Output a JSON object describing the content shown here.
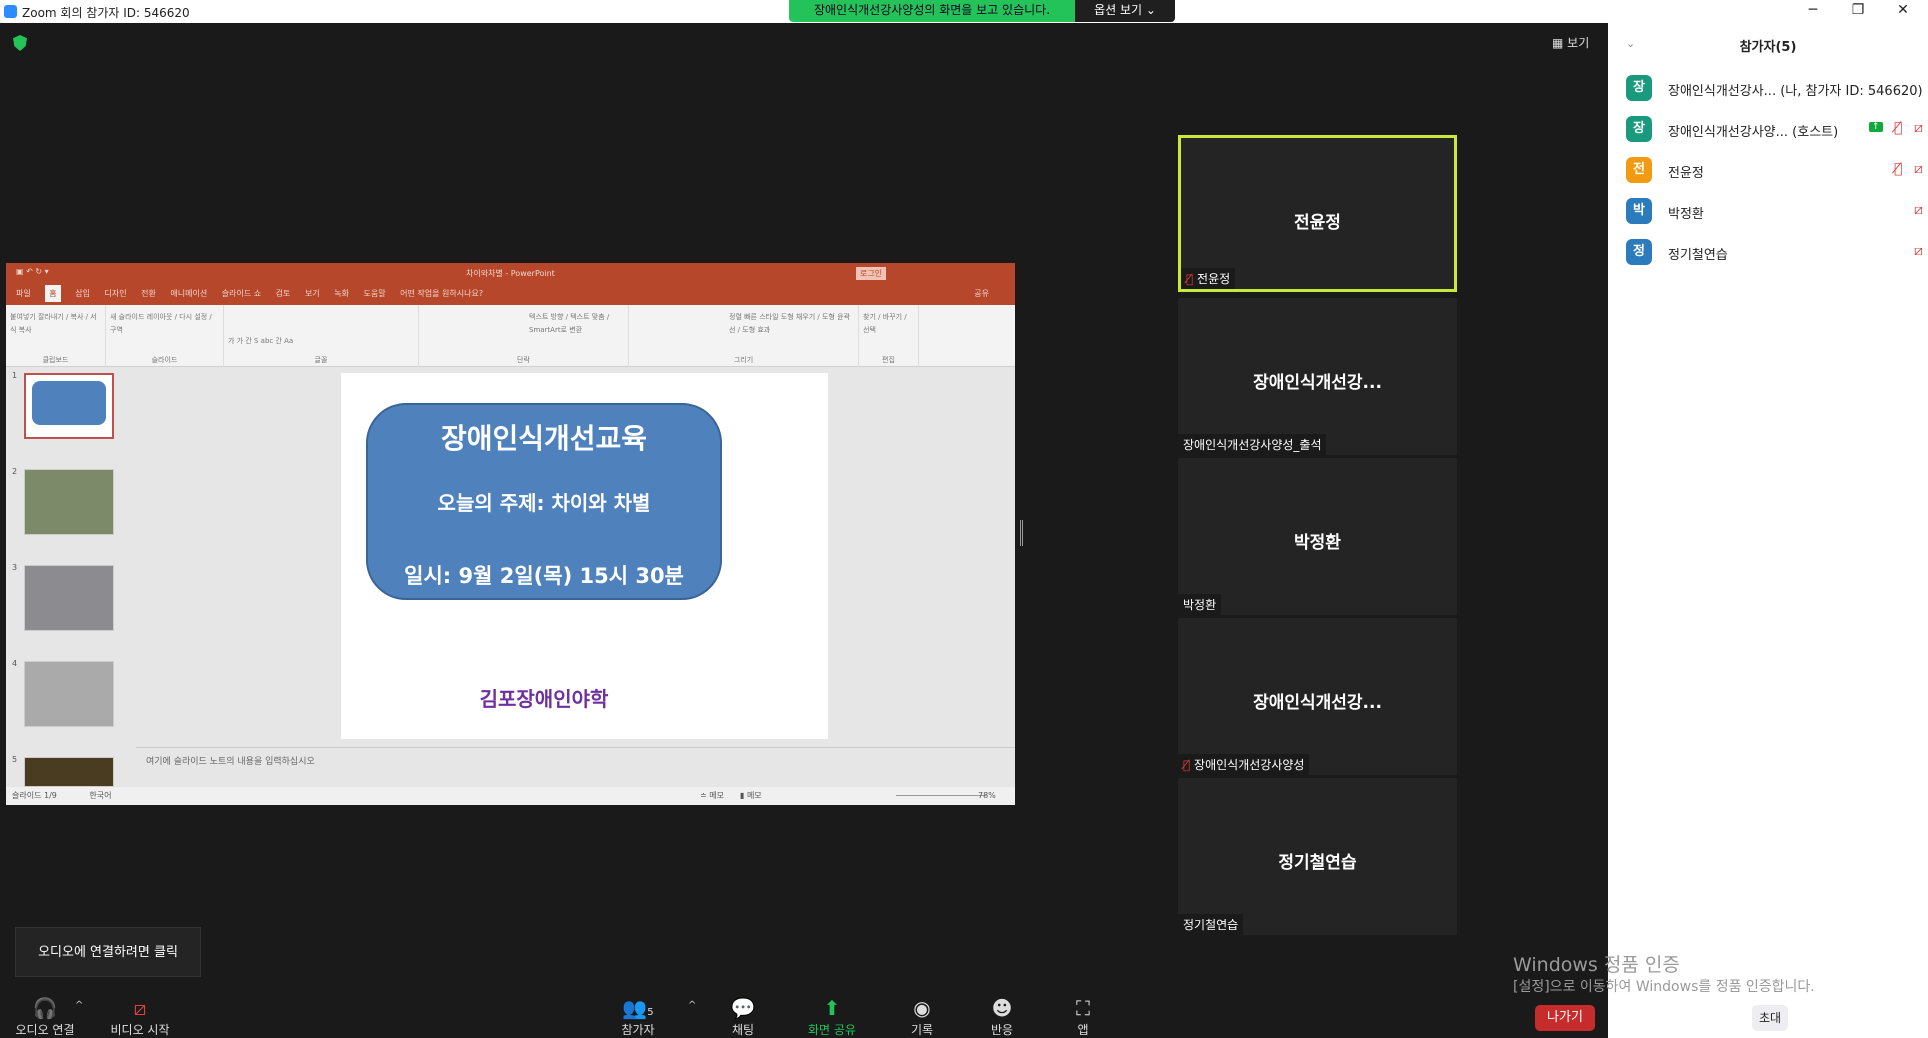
{
  "titlebar": {
    "title": "Zoom 회의 참가자 ID: 546620",
    "banner": "장애인식개선강사양성의 화면을 보고 있습니다.",
    "options": "옵션 보기 ⌄",
    "minimize": "─",
    "restore": "❐",
    "close": "✕"
  },
  "view_button": "▦ 보기",
  "ppt": {
    "title": "차이와차별 - PowerPoint",
    "login": "로그인",
    "share": "공유",
    "tabs": [
      "파일",
      "홈",
      "삽입",
      "디자인",
      "전환",
      "애니메이션",
      "슬라이드 쇼",
      "검토",
      "보기",
      "녹화",
      "도움말"
    ],
    "tellme": "어떤 작업을 원하시나요?",
    "groups": [
      {
        "label": "클립보드",
        "items": "붙여넣기  잘라내기 / 복사 / 서식 복사"
      },
      {
        "label": "슬라이드",
        "items": "새 슬라이드  레이아웃 / 다시 설정 / 구역"
      },
      {
        "label": "글꼴",
        "items": "가 가 간 S abc 간 Aa"
      },
      {
        "label": "단락",
        "items": "텍스트 방향 / 텍스트 맞춤 / SmartArt로 변환"
      },
      {
        "label": "그리기",
        "items": "정렬  빠른 스타일  도형 채우기 / 도형 윤곽선 / 도형 효과"
      },
      {
        "label": "편집",
        "items": "찾기 / 바꾸기 / 선택"
      }
    ],
    "thumb_numbers": [
      "1",
      "2",
      "3",
      "4",
      "5"
    ],
    "slide": {
      "title": "장애인식개선교육",
      "topic": "오늘의 주제: 차이와 차별",
      "date": "일시: 9월 2일(목) 15시 30분",
      "org": "김포장애인야학"
    },
    "notes_placeholder": "여기에 슬라이드 노트의 내용을 입력하십시오",
    "status": {
      "slide": "슬라이드 1/9",
      "lang": "한국어",
      "notes": "≐ 메모",
      "comments": "▮ 메모",
      "zoom": "78%",
      "zoom_fraction": 0.78
    }
  },
  "tiles": [
    {
      "name": "전윤정",
      "label": "전윤정",
      "muted": true,
      "active": true
    },
    {
      "name": "장애인식개선강...",
      "label": "장애인식개선강사양성_출석",
      "muted": false
    },
    {
      "name": "박정환",
      "label": "박정환",
      "muted": false
    },
    {
      "name": "장애인식개선강...",
      "label": "장애인식개선강사양성",
      "muted": true
    },
    {
      "name": "정기철연습",
      "label": "정기철연습",
      "muted": false
    }
  ],
  "tooltip": "오디오에 연결하려면 클릭",
  "toolbar": {
    "audio": "오디오 연결",
    "video": "비디오 시작",
    "participants": "참가자",
    "participants_count": "5",
    "chat": "채팅",
    "share": "화면 공유",
    "record": "기록",
    "reactions": "반응",
    "apps": "앱"
  },
  "panel": {
    "title": "참가자(5)",
    "participants": [
      {
        "initial": "장",
        "name": "장애인식개선강사... (나, 참가자 ID: 546620)",
        "color": "#1a9a7c"
      },
      {
        "initial": "장",
        "name": "장애인식개선강사양... (호스트)",
        "color": "#1a9a7c",
        "sharing": true,
        "mic_muted": true,
        "video_off": true
      },
      {
        "initial": "전",
        "name": "전윤정",
        "color": "#f29b12",
        "mic_muted": true,
        "video_off": true
      },
      {
        "initial": "박",
        "name": "박정환",
        "color": "#2b7bbd",
        "video_off": true
      },
      {
        "initial": "정",
        "name": "정기철연습",
        "color": "#2b7bbd",
        "video_off": true
      }
    ]
  },
  "watermark": {
    "line1": "Windows 정품 인증",
    "line2": "[설정]으로 이동하여 Windows를 정품 인증합니다."
  },
  "leave": "나가기",
  "invite": "초대"
}
